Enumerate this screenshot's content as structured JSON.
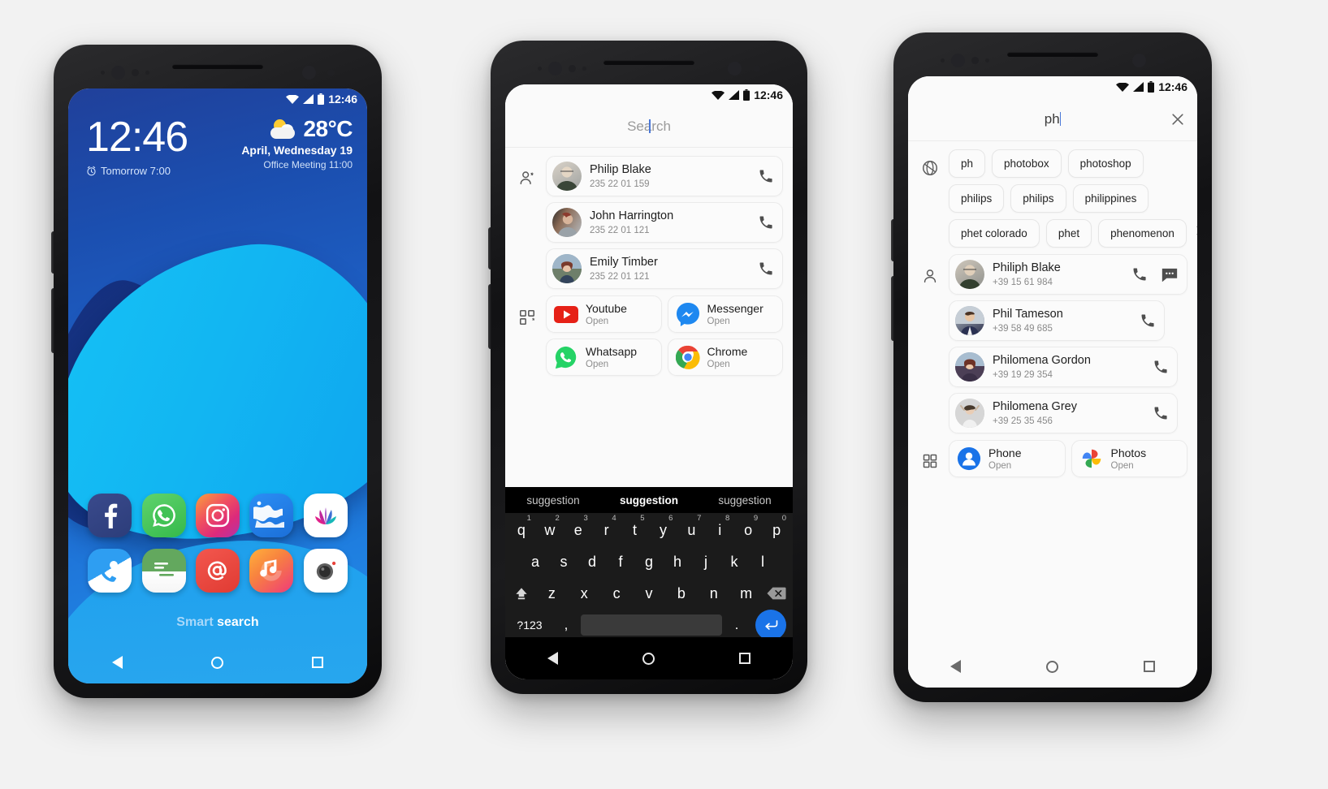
{
  "phone1": {
    "status": {
      "time": "12:46",
      "wifi": "wifi-icon",
      "signal": "signal-icon",
      "battery": "battery-icon"
    },
    "clock": "12:46",
    "alarm_icon": "alarm-clock-icon",
    "alarm": "Tomorrow 7:00",
    "weather": {
      "icon": "partly-cloudy-icon",
      "temp": "28°C",
      "date": "April, Wednesday 19",
      "event": "Office Meeting 11:00"
    },
    "apps": [
      {
        "name": "Facebook",
        "icon": "facebook-icon"
      },
      {
        "name": "Whatsapp",
        "icon": "whatsapp-icon"
      },
      {
        "name": "Instagram",
        "icon": "instagram-icon"
      },
      {
        "name": "Maps",
        "icon": "globe-maps-icon"
      },
      {
        "name": "Gallery",
        "icon": "lotus-gallery-icon"
      },
      {
        "name": "Contacts",
        "icon": "contacts-phone-icon"
      },
      {
        "name": "Messages",
        "icon": "messages-icon"
      },
      {
        "name": "Email",
        "icon": "email-at-icon"
      },
      {
        "name": "Music",
        "icon": "music-note-icon"
      },
      {
        "name": "Camera",
        "icon": "camera-icon"
      }
    ],
    "smart_search": {
      "part1": "Smart",
      "part2": "search"
    },
    "nav": {
      "back": "back-icon",
      "home": "home-icon",
      "recents": "recents-icon"
    }
  },
  "phone2": {
    "status": {
      "time": "12:46"
    },
    "search": {
      "placeholder": "Search",
      "value": ""
    },
    "contacts_group_icon": "person-add-icon",
    "contacts": [
      {
        "name": "Philip Blake",
        "number": "235 22 01 159",
        "call": "call-icon",
        "avatar": "avatar-philip"
      },
      {
        "name": "John Harrington",
        "number": "235 22 01 121",
        "call": "call-icon",
        "avatar": "avatar-john"
      },
      {
        "name": "Emily Timber",
        "number": "235 22 01 121",
        "call": "call-icon",
        "avatar": "avatar-emily"
      }
    ],
    "apps_group_icon": "apps-grid-add-icon",
    "apps": [
      {
        "name": "Youtube",
        "action": "Open",
        "icon": "youtube-icon"
      },
      {
        "name": "Messenger",
        "action": "Open",
        "icon": "messenger-icon"
      },
      {
        "name": "Whatsapp",
        "action": "Open",
        "icon": "whatsapp-icon"
      },
      {
        "name": "Chrome",
        "action": "Open",
        "icon": "chrome-icon"
      }
    ],
    "keyboard": {
      "suggestions": [
        "suggestion",
        "suggestion",
        "suggestion"
      ],
      "active_suggestion_index": 1,
      "row1": [
        {
          "k": "q",
          "n": "1"
        },
        {
          "k": "w",
          "n": "2"
        },
        {
          "k": "e",
          "n": "3"
        },
        {
          "k": "r",
          "n": "4"
        },
        {
          "k": "t",
          "n": "5"
        },
        {
          "k": "y",
          "n": "6"
        },
        {
          "k": "u",
          "n": "7"
        },
        {
          "k": "i",
          "n": "8"
        },
        {
          "k": "o",
          "n": "9"
        },
        {
          "k": "p",
          "n": "0"
        }
      ],
      "row2": [
        "a",
        "s",
        "d",
        "f",
        "g",
        "h",
        "j",
        "k",
        "l"
      ],
      "row3": [
        "z",
        "x",
        "c",
        "v",
        "b",
        "n",
        "m"
      ],
      "shift_icon": "shift-icon",
      "backspace_icon": "backspace-icon",
      "symbols_key": "?123",
      "comma_key": ",",
      "period_key": ".",
      "space_key": "",
      "enter_icon": "enter-icon"
    },
    "nav": {
      "back": "back-icon",
      "home": "home-icon",
      "recents": "recents-icon"
    }
  },
  "phone3": {
    "status": {
      "time": "12:46"
    },
    "search": {
      "value": "ph",
      "clear_icon": "close-icon"
    },
    "web_group_icon": "globe-web-icon",
    "suggestions": [
      "ph",
      "photobox",
      "photoshop",
      "philips",
      "philips",
      "philippines",
      "phet colorado",
      "phet",
      "phenomenon"
    ],
    "more_icon": "chevron-right-icon",
    "contacts_group_icon": "person-icon",
    "contacts": [
      {
        "name": "Philiph Blake",
        "number": "+39 15 61 984",
        "call": "call-icon",
        "message": "message-icon",
        "avatar": "avatar-philiph"
      },
      {
        "name": "Phil Tameson",
        "number": "+39 58 49 685",
        "call": "call-icon",
        "message": "",
        "avatar": "avatar-phil"
      },
      {
        "name": "Philomena Gordon",
        "number": "+39 19 29 354",
        "call": "call-icon",
        "message": "",
        "avatar": "avatar-gordon"
      },
      {
        "name": "Philomena Grey",
        "number": "+39 25 35 456",
        "call": "call-icon",
        "message": "",
        "avatar": "avatar-grey"
      }
    ],
    "apps_group_icon": "apps-grid-icon",
    "apps": [
      {
        "name": "Phone",
        "action": "Open",
        "icon": "phone-app-icon"
      },
      {
        "name": "Photos",
        "action": "Open",
        "icon": "google-photos-icon"
      }
    ],
    "nav": {
      "back": "back-icon",
      "home": "home-icon",
      "recents": "recents-icon"
    }
  },
  "colors": {
    "accent_blue": "#1a73e8",
    "wallpaper_dark": "#1b4fb0",
    "wallpaper_cyan": "#12b6f2"
  }
}
